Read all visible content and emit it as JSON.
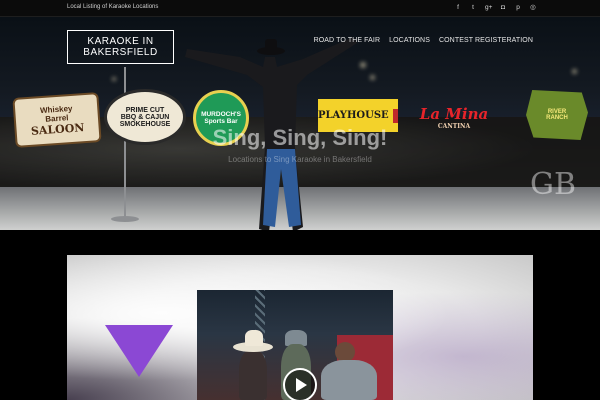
{
  "topbar": {
    "tagline": "Local Listing of Karaoke Locations",
    "social": [
      {
        "icon": "facebook-icon",
        "glyph": "f"
      },
      {
        "icon": "twitter-icon",
        "glyph": "t"
      },
      {
        "icon": "googleplus-icon",
        "glyph": "g+"
      },
      {
        "icon": "instagram-icon",
        "glyph": "◘"
      },
      {
        "icon": "pinterest-icon",
        "glyph": "p"
      },
      {
        "icon": "dribbble-icon",
        "glyph": "◎"
      }
    ]
  },
  "header": {
    "logo_line1": "KARAOKE IN",
    "logo_line2": "BAKERSFIELD",
    "nav": [
      "ROAD TO THE FAIR",
      "LOCATIONS",
      "CONTEST REGISTERATION"
    ]
  },
  "hero": {
    "title": "Sing, Sing, Sing!",
    "subtitle": "Locations to Sing Karaoke in Bakersfield",
    "watermark": "GB",
    "sponsors": {
      "whiskey_line1": "Whiskey",
      "whiskey_line2": "Barrel",
      "whiskey_line3": "SALOON",
      "prime_line1": "PRIME CUT",
      "prime_line2": "BBQ & CAJUN",
      "prime_line3": "SMOKEHOUSE",
      "murdoch_line1": "MURDOCH'S",
      "murdoch_line2": "Sports Bar",
      "playhouse": "PLAYHOUSE",
      "lamina": "La Mina",
      "lamina_sub": "CANTINA",
      "green_line1": "RIVER",
      "green_line2": "RANCH"
    }
  },
  "video": {
    "play_icon": "play-icon"
  },
  "colors": {
    "accent_triangle": "#8b48d4",
    "background": "#000000"
  }
}
